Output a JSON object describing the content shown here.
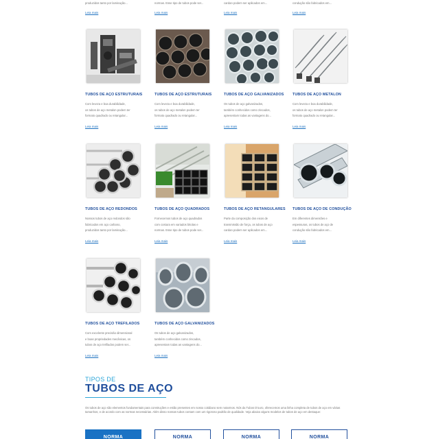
{
  "partial_row": [
    {
      "text": "produzidos tanto por laminação...",
      "link": "Leia mais"
    },
    {
      "text": "normas. Esse tipo de tubos pode ser...",
      "link": "Leia mais"
    },
    {
      "text": "cardan podem ser aplicados em...",
      "link": "Leia mais"
    },
    {
      "text": "condução são fabricados em...",
      "link": "Leia mais"
    }
  ],
  "products": [
    {
      "title": "TUBOS DE AÇO ESTRUTURAIS",
      "desc": [
        "Com leveza e boa durabilidade,",
        "os tubos de aço metalon podem ter",
        "formato quadrado ou retangular..."
      ],
      "link": "Leia mais",
      "icon": "machinery-photo"
    },
    {
      "title": "TUBOS DE AÇO ESTRUTURAIS",
      "desc": [
        "Com leveza e boa durabilidade,",
        "os tubos de aço metalon podem ter",
        "formato quadrado ou retangular..."
      ],
      "link": "Leia mais",
      "icon": "black-pipes-photo"
    },
    {
      "title": "TUBOS DE AÇO GALVANIZADOS",
      "desc": [
        "Os tubos de aço galvanizados,",
        "também conhecidos como zincados,",
        "apresentam todas as vantagens do..."
      ],
      "link": "Leia mais",
      "icon": "galvanized-pipes-photo"
    },
    {
      "title": "TUBOS DE AÇO METALON",
      "desc": [
        "Com leveza e boa durabilidade,",
        "os tubos de aço metalon podem ter",
        "formato quadrado ou retangular..."
      ],
      "link": "Leia mais",
      "icon": "square-tubes-photo"
    },
    {
      "title": "TUBOS DE AÇO REDONDOS",
      "desc": [
        "Nossos tubos de aço redondos são",
        "fabricados em aço carbono,",
        "produzidos tanto por laminação..."
      ],
      "link": "Leia mais",
      "icon": "round-pipes-photo"
    },
    {
      "title": "TUBOS DE AÇO QUADRADOS",
      "desc": [
        "Fornecemos tubos de aço quadrados",
        "com costura em variados bitolas e",
        "normas. Esse tipo de tubos pode ser..."
      ],
      "link": "Leia mais",
      "icon": "square-pipes-photo"
    },
    {
      "title": "TUBOS DE AÇO RETANGULARES",
      "desc": [
        "Parte da composição dos eixos de",
        "transmissão de força, os tubos de aço",
        "cardan podem ser aplicados em..."
      ],
      "link": "Leia mais",
      "icon": "rectangular-pipes-photo"
    },
    {
      "title": "TUBOS DE AÇO DE CONDUÇÃO",
      "desc": [
        "Em diferentes dimensões e",
        "espessuras, os tubos de aço de",
        "condução são fabricados em..."
      ],
      "link": "Leia mais",
      "icon": "conduction-pipes-photo"
    },
    {
      "title": "TUBOS DE AÇO TREFILADOS",
      "desc": [
        "Com excelente precisão dimensional",
        "e boas propriedades mecânicas, os",
        "tubos de aço trefilados podem ser..."
      ],
      "link": "Leia mais",
      "icon": "drawn-pipes-photo"
    },
    {
      "title": "TUBOS DE AÇO GALVANIZADOS",
      "desc": [
        "Os tubos de aço galvanizados,",
        "também conhecidos como zincados,",
        "apresentam todas as vantagens do..."
      ],
      "link": "Leia mais",
      "icon": "galvanized-fittings-photo"
    }
  ],
  "types_section": {
    "kicker": "TIPOS DE",
    "heading": "TUBOS DE AÇO",
    "paragraph": "Os tubos de aço são elementos fundamentais para construções e estão presentes em nosso cotidiano sem notarmos. Nós da Tubos D'ouro, oferecemos uma linha completa de tubos de aço em várias tamanhos, e de acordo com as normas necessárias. Além disso nossos tubos contam com um rigoroso padrão de qualidade. Veja abaixo alguns modelos de tubos de aço em destaque:"
  },
  "norm_buttons": [
    {
      "label": "NORMA",
      "active": true
    },
    {
      "label": "NORMA",
      "active": false
    },
    {
      "label": "NORMA",
      "active": false
    },
    {
      "label": "NORMA",
      "active": false
    }
  ],
  "colors": {
    "title_blue": "#1f4e9c",
    "accent_cyan": "#2aa5d8",
    "button_blue": "#1a72c4"
  }
}
